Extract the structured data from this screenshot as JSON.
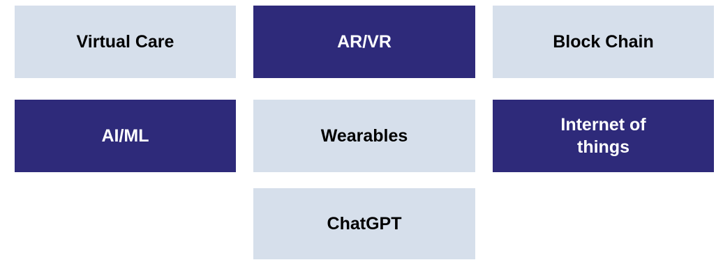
{
  "tiles": {
    "virtual_care": "Virtual Care",
    "ar_vr": "AR/VR",
    "block_chain": "Block Chain",
    "ai_ml": "AI/ML",
    "wearables": "Wearables",
    "internet_of_things": "Internet of things",
    "chatgpt": "ChatGPT"
  },
  "colors": {
    "light_tile": "#d6dfeb",
    "dark_tile": "#2e2a7a",
    "light_text": "#000000",
    "dark_text": "#ffffff"
  }
}
